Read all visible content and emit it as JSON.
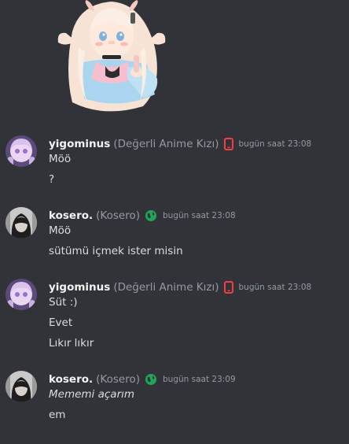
{
  "messages": [
    {
      "username": "yigominus",
      "nickname": "(Değerli Anime Kızı)",
      "status_icon": "mobile-phone-icon",
      "status_color": "#f23f43",
      "timestamp": "bugün saat 23:08",
      "lines": [
        "Möö",
        "?"
      ]
    },
    {
      "username": "kosero.",
      "nickname": "(Kosero)",
      "status_icon": "globe-icon",
      "status_color": "#23a559",
      "timestamp": "bugün saat 23:08",
      "lines": [
        "Möö",
        "sütümü içmek ister misin"
      ]
    },
    {
      "username": "yigominus",
      "nickname": "(Değerli Anime Kızı)",
      "status_icon": "mobile-phone-icon",
      "status_color": "#f23f43",
      "timestamp": "bugün saat 23:08",
      "lines": [
        "Süt :)",
        "Evet",
        "Lıkır lıkır"
      ]
    },
    {
      "username": "kosero.",
      "nickname": "(Kosero)",
      "status_icon": "globe-icon",
      "status_color": "#23a559",
      "timestamp": "bugün saat 23:09",
      "lines": [
        "Mememi açarım",
        "em"
      ]
    }
  ]
}
